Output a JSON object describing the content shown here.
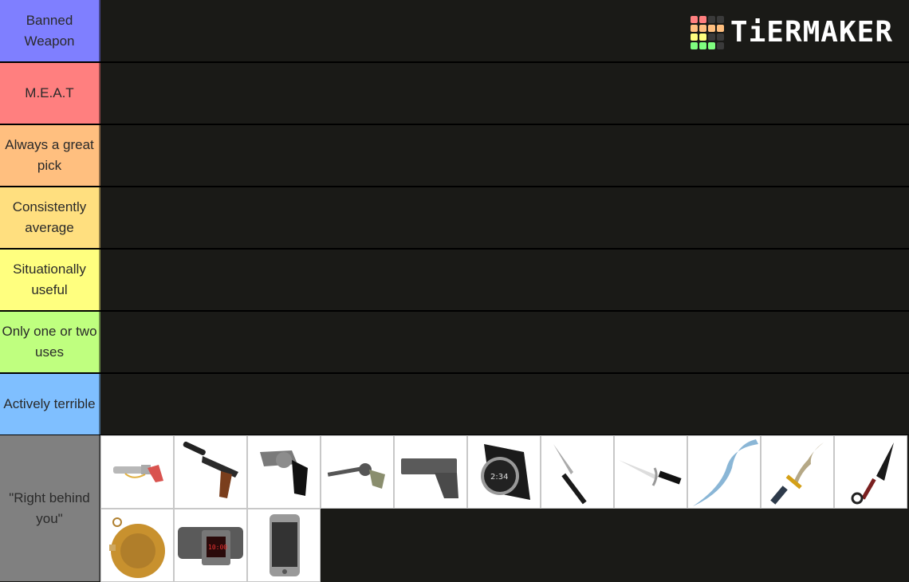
{
  "brand": {
    "logo_text": "TiERMAKER",
    "logo_grid": [
      [
        "#ff7f7f",
        "#ff7f7f",
        "#3a3a3a",
        "#3a3a3a"
      ],
      [
        "#ffbf7f",
        "#ffbf7f",
        "#ffbf7f",
        "#ffbf7f"
      ],
      [
        "#ffff7f",
        "#ffff7f",
        "#3a3a3a",
        "#3a3a3a"
      ],
      [
        "#7fff7f",
        "#7fff7f",
        "#7fff7f",
        "#3a3a3a"
      ]
    ]
  },
  "tiers": [
    {
      "label": "Banned Weapon",
      "color": "#7f7fff",
      "items": []
    },
    {
      "label": "M.E.A.T",
      "color": "#ff7f7f",
      "items": []
    },
    {
      "label": "Always a great pick",
      "color": "#ffbf7f",
      "items": []
    },
    {
      "label": "Consistently average",
      "color": "#ffdf7f",
      "items": []
    },
    {
      "label": "Situationally useful",
      "color": "#ffff7f",
      "items": []
    },
    {
      "label": "Only one or two uses",
      "color": "#bfff7f",
      "items": []
    },
    {
      "label": "Actively terrible",
      "color": "#7fbfff",
      "items": []
    },
    {
      "label": "\"Right behind you\"",
      "color": "#808080",
      "items": [
        {
          "name": "flare-gun",
          "icon": "flare-gun-icon"
        },
        {
          "name": "silenced-pistol",
          "icon": "silenced-pistol-icon"
        },
        {
          "name": "snub-revolver",
          "icon": "snub-revolver-icon"
        },
        {
          "name": "cowboy-revolver",
          "icon": "cowboy-revolver-icon"
        },
        {
          "name": "tactical-pistol",
          "icon": "tactical-pistol-icon"
        },
        {
          "name": "smart-watch",
          "icon": "smart-watch-icon"
        },
        {
          "name": "butterfly-knife",
          "icon": "butterfly-knife-icon"
        },
        {
          "name": "white-dagger",
          "icon": "white-dagger-icon"
        },
        {
          "name": "ice-blade",
          "icon": "ice-blade-icon"
        },
        {
          "name": "golden-kris",
          "icon": "golden-kris-icon"
        },
        {
          "name": "kunai",
          "icon": "kunai-icon"
        },
        {
          "name": "pocket-watch",
          "icon": "pocket-watch-icon"
        },
        {
          "name": "digital-watch",
          "icon": "digital-watch-icon"
        },
        {
          "name": "smartphone",
          "icon": "smartphone-icon"
        }
      ]
    }
  ]
}
